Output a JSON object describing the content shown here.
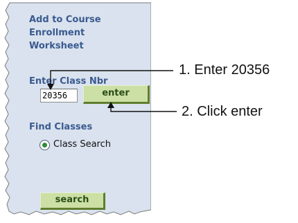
{
  "sidebar": {
    "add_heading": "Add to Course Enrollment Worksheet",
    "enter_class_nbr_label": "Enter Class Nbr",
    "class_nbr_value": "20356",
    "enter_button": "enter",
    "find_classes_heading": "Find Classes",
    "class_search_option": "Class Search",
    "search_button": "search"
  },
  "callouts": {
    "step1": "1. Enter 20356",
    "step2": "2. Click enter"
  },
  "colors": {
    "panel_bg": "#d9e2ee",
    "heading": "#3a5a8f",
    "button_bg": "#ccdfa4",
    "button_shadow": "#5e7d2e"
  }
}
